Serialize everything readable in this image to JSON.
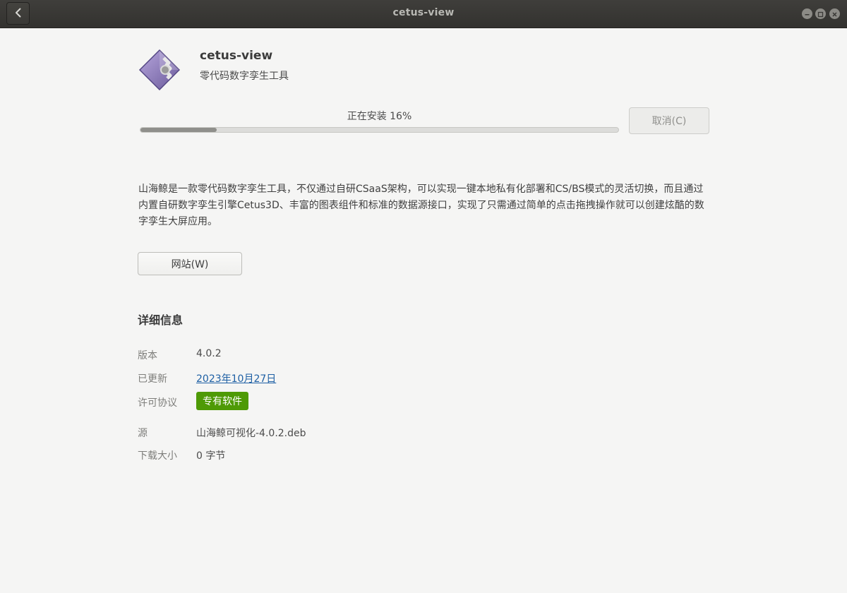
{
  "window": {
    "title": "cetus-view"
  },
  "app": {
    "name": "cetus-view",
    "summary": "零代码数字孪生工具"
  },
  "install": {
    "status": "正在安装 16%",
    "progress": 0.16,
    "cancel_label": "取消(C)"
  },
  "description": "山海鲸是一款零代码数字孪生工具，不仅通过自研CSaaS架构，可以实现一键本地私有化部署和CS/BS模式的灵活切换，而且通过内置自研数字孪生引擎Cetus3D、丰富的图表组件和标准的数据源接口，实现了只需通过简单的点击拖拽操作就可以创建炫酷的数字孪生大屏应用。",
  "website_label": "网站(W)",
  "details": {
    "title": "详细信息",
    "version": {
      "label": "版本",
      "value": "4.0.2"
    },
    "updated": {
      "label": "已更新",
      "value": "2023年10月27日"
    },
    "license": {
      "label": "许可协议",
      "value": "专有软件"
    },
    "source": {
      "label": "源",
      "value": "山海鲸可视化-4.0.2.deb"
    },
    "download_size": {
      "label": "下载大小",
      "value": "0 字节"
    }
  },
  "colors": {
    "license_badge": "#4e9a06",
    "link": "#1d5fa4",
    "titlebar": "#3a3936"
  },
  "icons": {
    "back": "chevron-left-icon",
    "app": "app-package-icon"
  }
}
